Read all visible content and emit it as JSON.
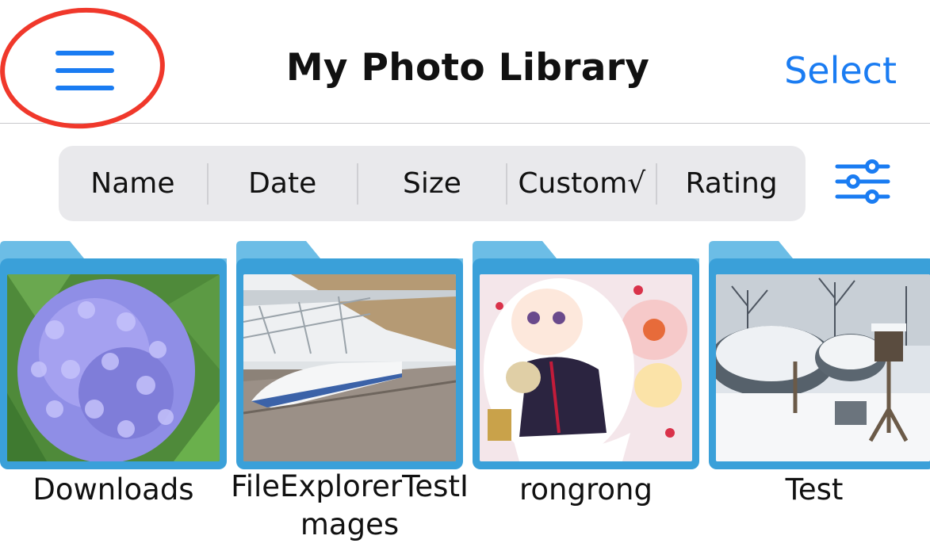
{
  "header": {
    "title": "My Photo Library",
    "select_label": "Select",
    "menu_icon": "hamburger-menu-icon"
  },
  "sort_bar": {
    "options": [
      {
        "label": "Name"
      },
      {
        "label": "Date"
      },
      {
        "label": "Size"
      },
      {
        "label": "Custom√"
      },
      {
        "label": "Rating"
      }
    ],
    "filter_icon": "sliders-icon"
  },
  "folders": [
    {
      "name": "Downloads",
      "thumbnail": "hydrangea-photo"
    },
    {
      "name": "FileExplorerTestImages",
      "thumbnail": "train-station-photo"
    },
    {
      "name": "rongrong",
      "thumbnail": "anime-illustration"
    },
    {
      "name": "Test",
      "thumbnail": "snow-garden-photo"
    }
  ],
  "colors": {
    "accent": "#1a7cf2",
    "folder": "#3aa0d9",
    "folder_tab": "#6cbde6",
    "annotation": "#f0382b",
    "segment_bg": "#e9e9ec"
  }
}
